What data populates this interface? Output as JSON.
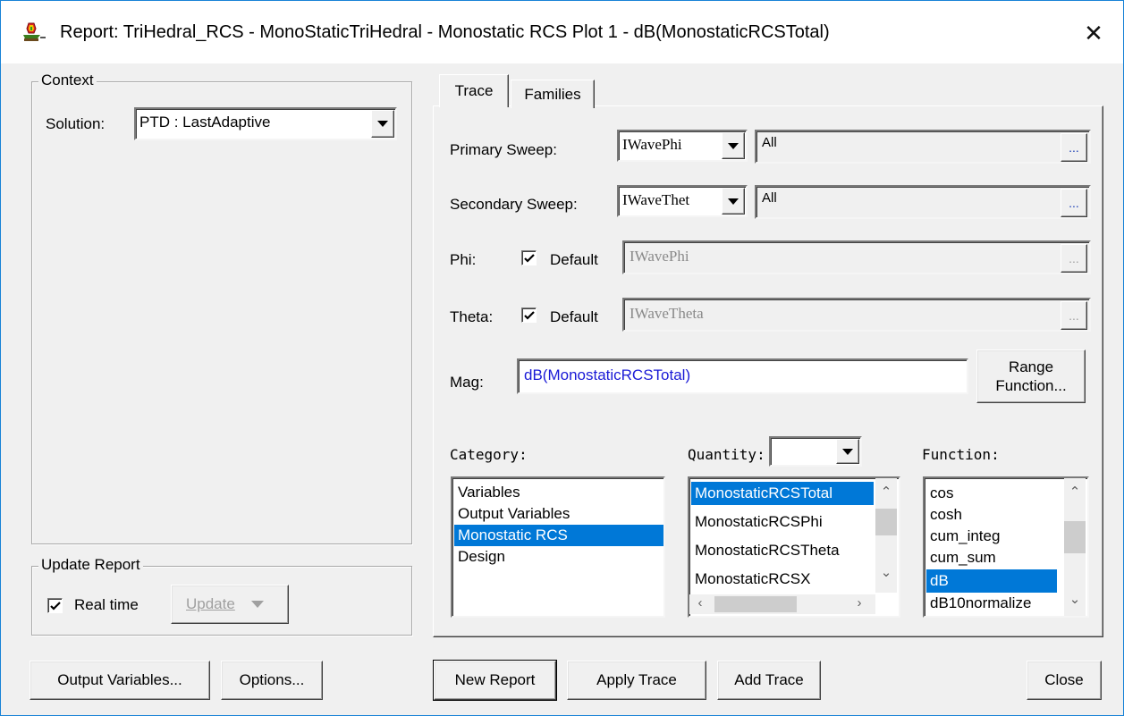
{
  "window": {
    "title": "Report: TriHedral_RCS - MonoStaticTriHedral - Monostatic RCS Plot 1 - dB(MonostaticRCSTotal)",
    "close_glyph": "✕"
  },
  "context": {
    "legend": "Context",
    "solution_label": "Solution:",
    "solution_value": "PTD : LastAdaptive"
  },
  "update_report": {
    "legend": "Update Report",
    "realtime_label": "Real time",
    "realtime_checked": true,
    "update_button": "Update"
  },
  "tabs": [
    {
      "label": "Trace",
      "active": true
    },
    {
      "label": "Families",
      "active": false
    }
  ],
  "trace": {
    "primary_sweep": {
      "label": "Primary Sweep:",
      "variable": "IWavePhi",
      "value": "All",
      "button": "..."
    },
    "secondary_sweep": {
      "label": "Secondary Sweep:",
      "variable": "IWaveThet",
      "value": "All",
      "button": "..."
    },
    "phi": {
      "label": "Phi:",
      "default_label": "Default",
      "default_checked": true,
      "value": "IWavePhi",
      "button": "..."
    },
    "theta": {
      "label": "Theta:",
      "default_label": "Default",
      "default_checked": true,
      "value": "IWaveTheta",
      "button": "..."
    },
    "mag": {
      "label": "Mag:",
      "value": "dB(MonostaticRCSTotal)",
      "value_color": "#1a1ad6"
    },
    "range_function_line1": "Range",
    "range_function_line2": "Function...",
    "category": {
      "label": "Category:",
      "items": [
        "Variables",
        "Output Variables",
        "Monostatic RCS",
        "Design"
      ],
      "selected": "Monostatic RCS"
    },
    "quantity": {
      "label": "Quantity:",
      "filter_value": "",
      "items": [
        "MonostaticRCSTotal",
        "MonostaticRCSPhi",
        "MonostaticRCSTheta",
        "MonostaticRCSX"
      ],
      "selected": "MonostaticRCSTotal"
    },
    "function": {
      "label": "Function:",
      "items": [
        "cos",
        "cosh",
        "cum_integ",
        "cum_sum",
        "dB",
        "dB10normalize"
      ],
      "selected": "dB"
    }
  },
  "buttons": {
    "output_variables": "Output Variables...",
    "options": "Options...",
    "new_report": "New Report",
    "apply_trace": "Apply Trace",
    "add_trace": "Add Trace",
    "close": "Close"
  },
  "colors": {
    "selection": "#0078d7",
    "dialog_bg": "#f0f0f0",
    "window_border": "#1883d7"
  }
}
